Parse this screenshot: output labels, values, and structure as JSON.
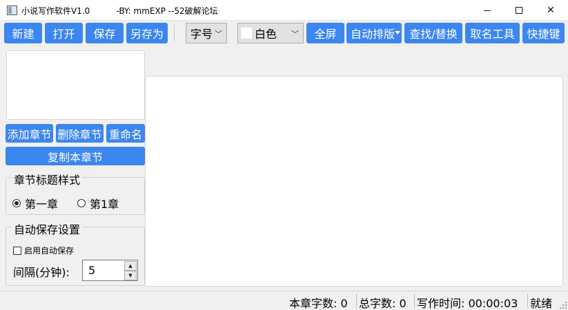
{
  "window": {
    "title": "小说写作软件V1.0          -BY: mmEXP --52破解论坛",
    "controls": {
      "minimize": "minimize",
      "maximize": "maximize",
      "close": "✕"
    }
  },
  "toolbar": {
    "new": "新建",
    "open": "打开",
    "save": "保存",
    "save_as": "另存为",
    "font_size": "字号",
    "color": "白色",
    "fullscreen": "全屏",
    "auto_layout": "自动排版",
    "find_replace": "查找/替换",
    "naming_tool": "取名工具",
    "shortcuts": "快捷键"
  },
  "sidebar": {
    "add_chapter": "添加章节",
    "delete_chapter": "删除章节",
    "rename": "重命名",
    "copy_chapter": "复制本章节",
    "title_style": {
      "label": "章节标题样式",
      "options": [
        "第一章",
        "第1章"
      ],
      "selected": "第一章"
    },
    "autosave": {
      "label": "自动保存设置",
      "enable_label": "启用自动保存",
      "enabled": false,
      "interval_label": "间隔(分钟):",
      "interval_value": "5"
    }
  },
  "status": {
    "chapter_words": "本章字数: 0",
    "total_words": "总字数: 0",
    "writing_time": "写作时间: 00:00:03",
    "state": "就绪"
  },
  "colors": {
    "accent": "#3c86f0",
    "background": "#f0f0f0"
  }
}
